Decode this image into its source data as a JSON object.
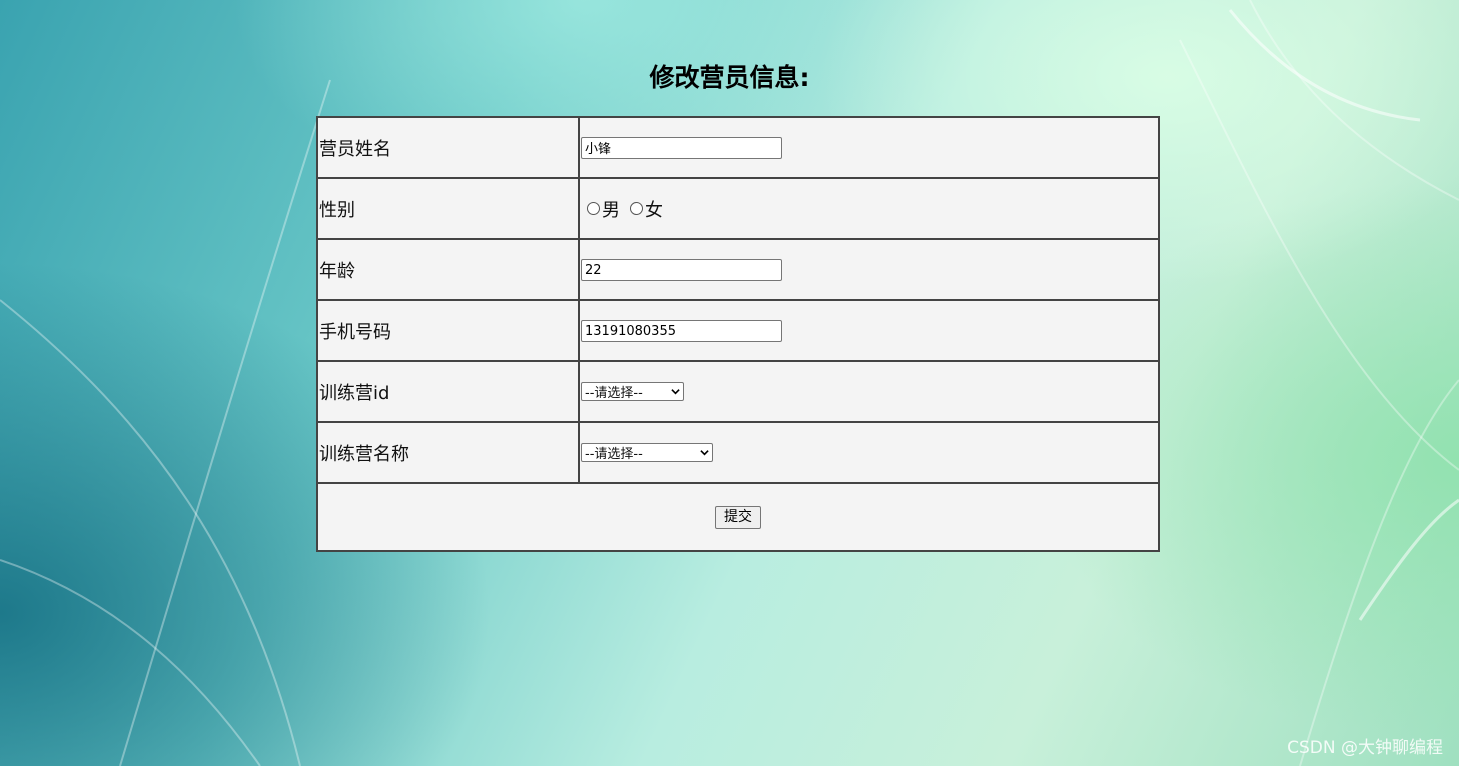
{
  "page": {
    "title": "修改营员信息:"
  },
  "form": {
    "name_label": "营员姓名",
    "name_value": "小锋",
    "gender_label": "性别",
    "gender_options": [
      "男",
      "女"
    ],
    "age_label": "年龄",
    "age_value": "22",
    "phone_label": "手机号码",
    "phone_value": "13191080355",
    "camp_id_label": "训练营id",
    "camp_id_selected": "--请选择--",
    "camp_name_label": "训练营名称",
    "camp_name_selected": "--请选择--",
    "submit_label": "提交"
  },
  "watermark": "CSDN @大钟聊编程",
  "icons": {
    "radio": "radio-icon",
    "dropdown": "chevron-down-icon"
  },
  "colors": {
    "table_bg": "#f4f4f4",
    "border": "#444444",
    "background_start": "#3aa3b0",
    "background_end": "#9fe0c0"
  }
}
